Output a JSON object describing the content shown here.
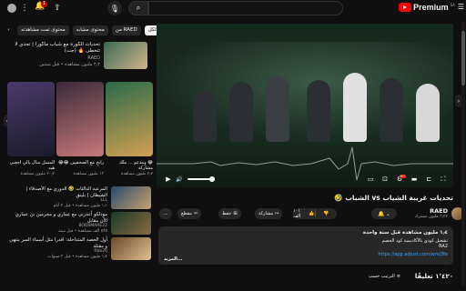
{
  "header": {
    "notification_count": "1",
    "logo_text": "Premium",
    "logo_region": "SA",
    "search_placeholder": ""
  },
  "chips": [
    {
      "label": "الكل",
      "active": true
    },
    {
      "label": "من RAED",
      "active": false
    },
    {
      "label": "محتوى مشابه",
      "active": false
    },
    {
      "label": "محتوى تمت مشاهدته",
      "active": false
    }
  ],
  "side_top": {
    "title": "تحديات الكورة مع شباب ماكورا | تحدي لا تتخطى 🔥 (جت)",
    "channel": "RAED",
    "meta": "٢٫٢ مليون مشاهدة • قبل سنتين"
  },
  "shorts": [
    {
      "caption": "المسل سال بالي اجغني هيه",
      "views": "٢٠٫٢ مليون مشاهدة"
    },
    {
      "caption": "رابح مع الصحفيين 😂😂",
      "views": "١٣ مليون مشاهدة"
    },
    {
      "caption": "😂 ومدعو ... ملك مشاركة",
      "views": "٢٫٢ مليون مشاهدة"
    }
  ],
  "list": [
    {
      "title": "المرعبة الدالتات 🤣 الدوري مع الأصدقاء | الشيطان | بلينق",
      "channel": "LLL",
      "meta": "١٫١ مليون مشاهدة • قبل ٢ أيام"
    },
    {
      "title": "مودلكو أعذرني مع عماري و مجرمين بن عماري الآن مقابل",
      "channel": "BODSMARE22",
      "meta": "٥٩٥ ألف مشاهدة • قبل سنة"
    },
    {
      "title": "أول الحصة المتداخلة: اقدرا مثل أسماء السر ينتهي و مقتلة",
      "channel": "Rbb20",
      "meta": "١٫٤ مليون مشاهدة • قبل ٣ سنوات"
    }
  ],
  "video": {
    "title": "تحديات غريبة الشياب vs الشباب 🤣",
    "channel": "RAED",
    "subscribers": "٣٫٣٢ مليون مشترك",
    "likes": "١٠١ ألف",
    "share_label": "مشاركة",
    "save_label": "حفظ",
    "clip_label": "مقطع",
    "more_label": "...",
    "progress": 0.45
  },
  "description": {
    "line1": "١٫٤ مليون مشاهدة قبل سنة واحدة",
    "line2": "تشغيل كودي بالأكاديمية كود الخصم",
    "line3": "RA2",
    "link": "https://app.adjust.com/wmj3fe",
    "more": "...المزيد"
  },
  "comments": {
    "count": "١٬٤٢٠ تعليقًا",
    "sort_label": "الترتيب حسب"
  },
  "colors": {
    "accent": "#ff0000",
    "background": "#0f0f0f",
    "surface": "#272727",
    "link": "#3ea6ff"
  }
}
